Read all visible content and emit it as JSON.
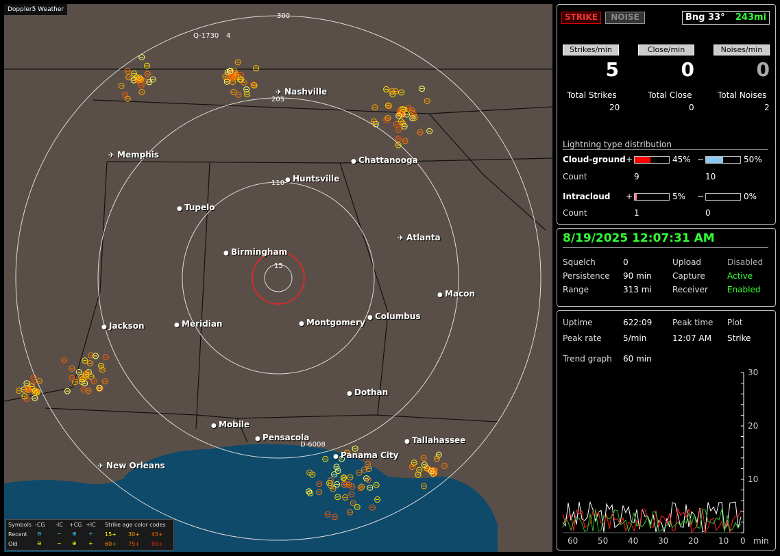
{
  "app": {
    "title": "Doppler5 Weather"
  },
  "map": {
    "range_labels": [
      "300",
      "205",
      "110",
      "15"
    ],
    "cities": [
      {
        "name": "Nashville",
        "icon": "airport-icon"
      },
      {
        "name": "Memphis",
        "icon": "airport-icon"
      },
      {
        "name": "Chattanooga",
        "icon": "city-dot-icon"
      },
      {
        "name": "Huntsville",
        "icon": "city-dot-icon"
      },
      {
        "name": "Tupelo",
        "icon": "city-dot-icon"
      },
      {
        "name": "Atlanta",
        "icon": "airport-icon"
      },
      {
        "name": "Birmingham",
        "icon": "city-dot-icon"
      },
      {
        "name": "Macon",
        "icon": "city-dot-icon"
      },
      {
        "name": "Jackson",
        "icon": "city-dot-icon"
      },
      {
        "name": "Meridian",
        "icon": "city-dot-icon"
      },
      {
        "name": "Montgomery",
        "icon": "city-dot-icon"
      },
      {
        "name": "Columbus",
        "icon": "city-dot-icon"
      },
      {
        "name": "Dothan",
        "icon": "city-dot-icon"
      },
      {
        "name": "Mobile",
        "icon": "city-dot-icon"
      },
      {
        "name": "Pensacola",
        "icon": "city-dot-icon"
      },
      {
        "name": "Tallahassee",
        "icon": "city-dot-icon"
      },
      {
        "name": "Panama City",
        "icon": "city-dot-icon"
      },
      {
        "name": "New Orleans",
        "icon": "airport-icon"
      }
    ],
    "annotations": [
      "Q-1730",
      "4",
      "D-6008"
    ],
    "legend": {
      "symbols_label": "Symbols",
      "cols": [
        "-CG",
        "-IC",
        "+CG",
        "+IC"
      ],
      "recent_label": "Recent",
      "old_label": "Old",
      "age_title": "Strike age color codes",
      "recent_ages": [
        "15+",
        "30+",
        "45+"
      ],
      "old_ages": [
        "60+",
        "75+",
        "90+"
      ],
      "recent_colors": [
        "#ffff00",
        "#ffa500",
        "#ff6a00"
      ],
      "old_colors": [
        "#ff8c00",
        "#ff5a00",
        "#ff2a00"
      ]
    }
  },
  "status": {
    "strike_button": "STRIKE",
    "noise_button": "NOISE",
    "bearing": "Bng 33°",
    "distance": "243mi",
    "strikes_per_min_label": "Strikes/min",
    "close_per_min_label": "Close/min",
    "noises_per_min_label": "Noises/min",
    "strikes_per_min": "5",
    "close_per_min": "0",
    "noises_per_min": "0",
    "total_strikes_label": "Total Strikes",
    "total_close_label": "Total Close",
    "total_noises_label": "Total Noises",
    "total_strikes": "20",
    "total_close": "0",
    "total_noises": "2",
    "distribution_title": "Lightning type distribution",
    "cg_label": "Cloud-ground",
    "ic_label": "Intracloud",
    "count_label": "Count",
    "plus_sign": "+",
    "minus_sign": "−",
    "cg_plus_pct": "45%",
    "cg_minus_pct": "50%",
    "cg_plus_count": "9",
    "cg_minus_count": "10",
    "ic_plus_pct": "5%",
    "ic_minus_pct": "0%",
    "ic_plus_count": "1",
    "ic_minus_count": "0",
    "bars": {
      "cg_plus": 0.45,
      "cg_minus": 0.5,
      "ic_plus": 0.05,
      "ic_minus": 0
    },
    "colors": {
      "cg_plus": "#ff0000",
      "cg_minus": "#8ec8f0",
      "ic_plus": "#ff6fae",
      "ic_minus": "#666666"
    }
  },
  "info": {
    "datetime": "8/19/2025 12:07:31 AM",
    "squelch_label": "Squelch",
    "squelch": "0",
    "persistence_label": "Persistence",
    "persistence": "90 min",
    "range_label": "Range",
    "range": "313 mi",
    "upload_label": "Upload",
    "upload": "Disabled",
    "capture_label": "Capture",
    "capture": "Active",
    "receiver_label": "Receiver",
    "receiver": "Enabled"
  },
  "stats": {
    "uptime_label": "Uptime",
    "uptime": "622:09",
    "peak_time_label": "Peak time",
    "peak_time": "12:07 AM",
    "plot_label": "Plot",
    "plot": "Strike",
    "peak_rate_label": "Peak rate",
    "peak_rate": "5/min",
    "trend_label": "Trend graph",
    "trend": "60 min"
  },
  "chart_data": {
    "type": "line",
    "x_ticks": [
      "60",
      "50",
      "40",
      "30",
      "20",
      "10",
      "0"
    ],
    "x_unit": "min",
    "y_ticks": [
      "30",
      "20",
      "10"
    ],
    "ylim": [
      0,
      30
    ]
  }
}
